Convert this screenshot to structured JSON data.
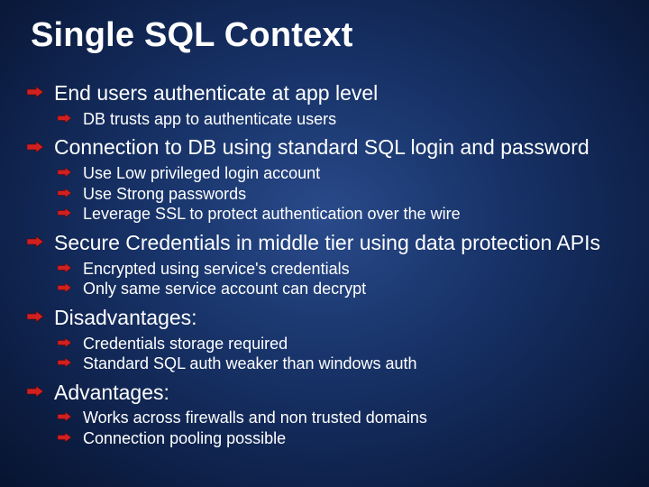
{
  "title": "Single SQL Context",
  "items": [
    {
      "text": "End users authenticate at app level",
      "sub": [
        "DB trusts app to authenticate users"
      ]
    },
    {
      "text": "Connection to DB using standard SQL login and password",
      "sub": [
        "Use Low privileged login account",
        "Use Strong passwords",
        "Leverage SSL to protect authentication over the wire"
      ]
    },
    {
      "text": "Secure Credentials in middle tier using data protection APIs",
      "sub": [
        "Encrypted using service's credentials",
        "Only same service account can decrypt"
      ]
    },
    {
      "text": "Disadvantages:",
      "sub": [
        "Credentials storage required",
        "Standard SQL auth weaker than windows auth"
      ]
    },
    {
      "text": "Advantages:",
      "sub": [
        "Works across firewalls and non trusted domains",
        "Connection pooling possible"
      ]
    }
  ]
}
